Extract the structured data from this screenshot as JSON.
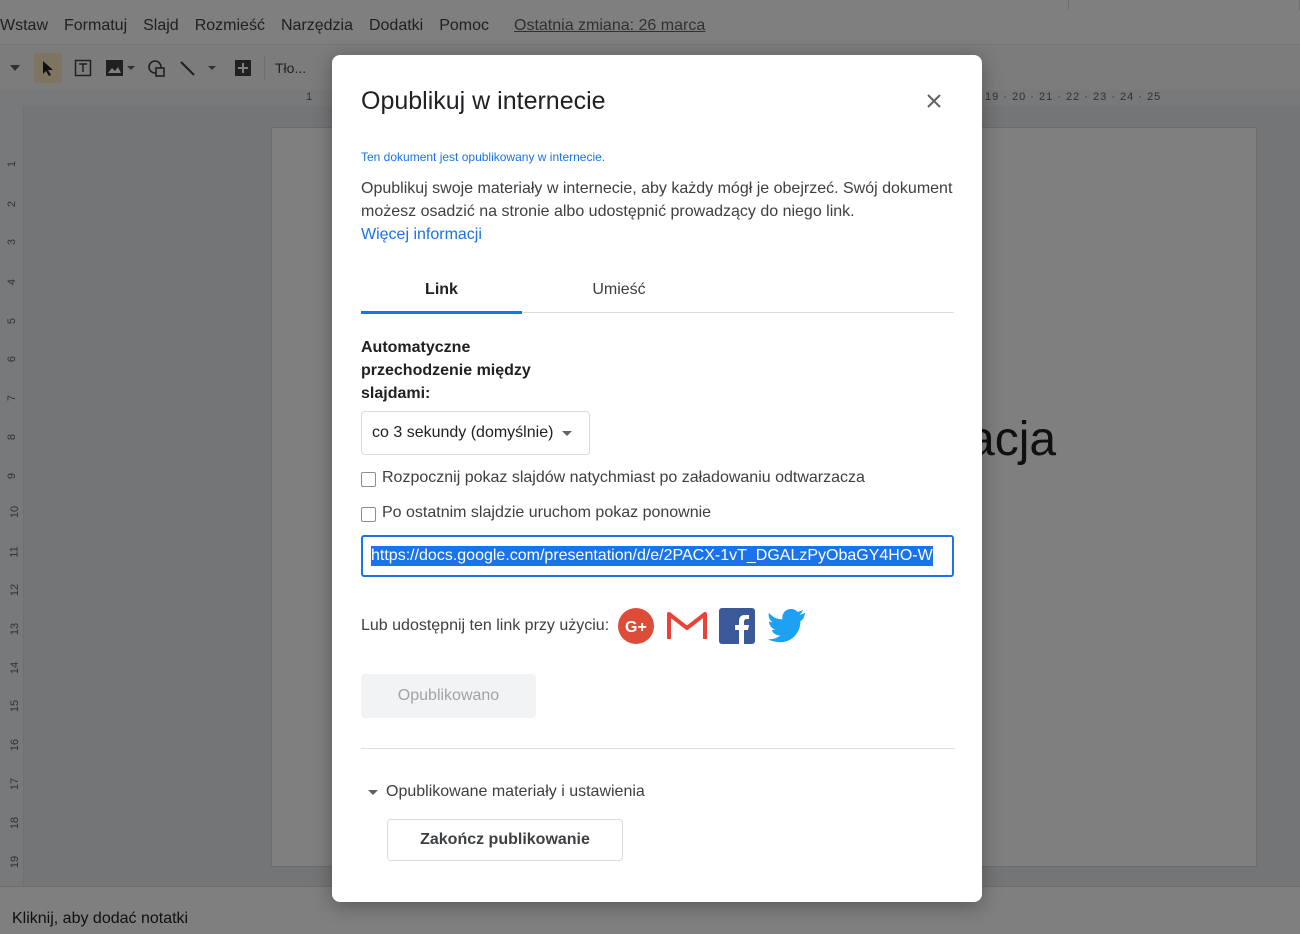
{
  "menubar": {
    "items": [
      "Wstaw",
      "Formatuj",
      "Slajd",
      "Rozmieść",
      "Narzędzia",
      "Dodatki",
      "Pomoc"
    ],
    "last_edit": "Ostatnia zmiana: 26 marca"
  },
  "toolbar": {
    "background_label": "Tło..."
  },
  "ruler": {
    "top_left": "1",
    "top_right": "19 · 20 · 21 · 22 · 23 · 24 · 25",
    "left": [
      "1",
      "2",
      "3",
      "4",
      "5",
      "6",
      "7",
      "8",
      "9",
      "10",
      "11",
      "12",
      "13",
      "14",
      "15",
      "16",
      "17",
      "18",
      "19"
    ]
  },
  "slide": {
    "text": "acja"
  },
  "notes": {
    "placeholder": "Kliknij, aby dodać notatki"
  },
  "dialog": {
    "title": "Opublikuj w internecie",
    "status": "Ten dokument jest opublikowany w internecie.",
    "description": "Opublikuj swoje materiały w internecie, aby każdy mógł je obejrzeć. Swój dokument możesz osadzić na stronie albo udostępnić prowadzący do niego link.",
    "more_link": "Więcej informacji",
    "tabs": [
      {
        "label": "Link",
        "active": true
      },
      {
        "label": "Umieść",
        "active": false
      }
    ],
    "auto_advance_label": "Automatyczne przechodzenie między slajdami:",
    "auto_advance_value": "co 3 sekundy (domyślnie)",
    "checkbox_start": {
      "label": "Rozpocznij pokaz slajdów natychmiast po załadowaniu odtwarzacza",
      "checked": false
    },
    "checkbox_loop": {
      "label": "Po ostatnim slajdzie uruchom pokaz ponownie",
      "checked": false
    },
    "url": "https://docs.google.com/presentation/d/e/2PACX-1vT_DGALzPyObaGY4HO-W",
    "share_label": "Lub udostępnij ten link przy użyciu:",
    "share_icons": [
      "google-plus-icon",
      "gmail-icon",
      "facebook-icon",
      "twitter-icon"
    ],
    "published_button": "Opublikowano",
    "section_label": "Opublikowane materiały i ustawienia",
    "stop_button": "Zakończ publikowanie"
  },
  "colors": {
    "accent": "#1a73e8",
    "google_plus": "#dd4b39",
    "gmail": "#ea4335",
    "facebook": "#3b5998",
    "twitter": "#1da1f2"
  }
}
